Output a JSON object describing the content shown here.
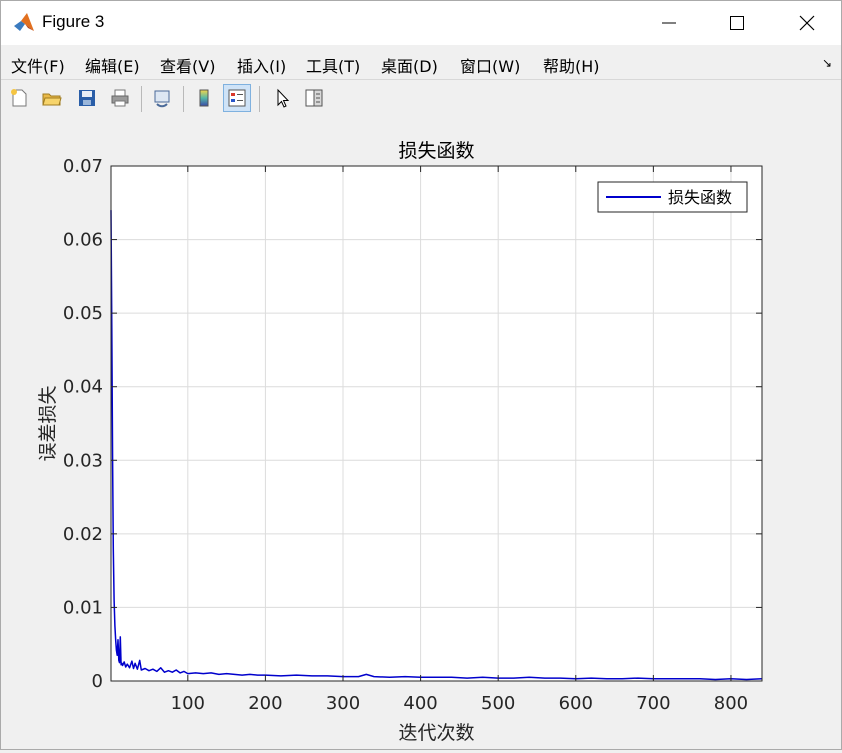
{
  "window": {
    "title": "Figure 3",
    "app_icon": "matlab-icon",
    "controls": [
      "minimize-icon",
      "maximize-icon",
      "close-icon"
    ]
  },
  "menu": {
    "items": [
      "文件(F)",
      "编辑(E)",
      "查看(V)",
      "插入(I)",
      "工具(T)",
      "桌面(D)",
      "窗口(W)",
      "帮助(H)"
    ]
  },
  "toolbar": {
    "icons": [
      "new-figure-icon",
      "open-file-icon",
      "save-icon",
      "print-icon",
      "link-plot-icon",
      "colorbar-icon",
      "legend-icon",
      "pointer-icon",
      "property-inspector-icon"
    ],
    "active": "legend-icon"
  },
  "chart_data": {
    "type": "line",
    "title": "损失函数",
    "xlabel": "迭代次数",
    "ylabel": "误差损失",
    "xlim": [
      1,
      840
    ],
    "ylim": [
      0,
      0.07
    ],
    "xticks": [
      100,
      200,
      300,
      400,
      500,
      600,
      700,
      800
    ],
    "yticks": [
      0,
      0.01,
      0.02,
      0.03,
      0.04,
      0.05,
      0.06,
      0.07
    ],
    "ytick_labels": [
      "0",
      "0.01",
      "0.02",
      "0.03",
      "0.04",
      "0.05",
      "0.06",
      "0.07"
    ],
    "grid": true,
    "legend_position": "top-right",
    "series": [
      {
        "name": "损失函数",
        "color": "#0000cc",
        "x": [
          1,
          2,
          3,
          4,
          5,
          6,
          7,
          8,
          9,
          10,
          11,
          12,
          13,
          14,
          15,
          16,
          18,
          20,
          22,
          25,
          28,
          30,
          32,
          35,
          38,
          40,
          45,
          50,
          55,
          60,
          65,
          70,
          75,
          80,
          85,
          90,
          95,
          100,
          110,
          120,
          130,
          140,
          150,
          160,
          170,
          180,
          190,
          200,
          220,
          240,
          260,
          280,
          300,
          320,
          330,
          340,
          360,
          380,
          400,
          420,
          440,
          460,
          480,
          500,
          520,
          540,
          560,
          580,
          600,
          620,
          640,
          660,
          680,
          700,
          720,
          740,
          760,
          780,
          800,
          820,
          840
        ],
        "y": [
          0.064,
          0.048,
          0.03,
          0.018,
          0.011,
          0.0075,
          0.0055,
          0.0042,
          0.0035,
          0.0056,
          0.0028,
          0.0025,
          0.006,
          0.0022,
          0.0024,
          0.0021,
          0.0026,
          0.0019,
          0.0023,
          0.0018,
          0.0027,
          0.0017,
          0.0024,
          0.0016,
          0.0028,
          0.0015,
          0.0017,
          0.0014,
          0.0016,
          0.0013,
          0.0018,
          0.0012,
          0.0014,
          0.0012,
          0.0015,
          0.0011,
          0.0013,
          0.001,
          0.0011,
          0.001,
          0.0011,
          0.0009,
          0.001,
          0.0009,
          0.0008,
          0.0009,
          0.0008,
          0.0008,
          0.0007,
          0.0008,
          0.0007,
          0.0007,
          0.0006,
          0.0006,
          0.0009,
          0.0006,
          0.0005,
          0.0006,
          0.0005,
          0.0005,
          0.0005,
          0.0004,
          0.0005,
          0.0004,
          0.0004,
          0.0005,
          0.0004,
          0.0004,
          0.0003,
          0.0004,
          0.0003,
          0.0003,
          0.0004,
          0.0003,
          0.0003,
          0.0003,
          0.0003,
          0.0002,
          0.0003,
          0.0002,
          0.0003
        ]
      }
    ]
  }
}
